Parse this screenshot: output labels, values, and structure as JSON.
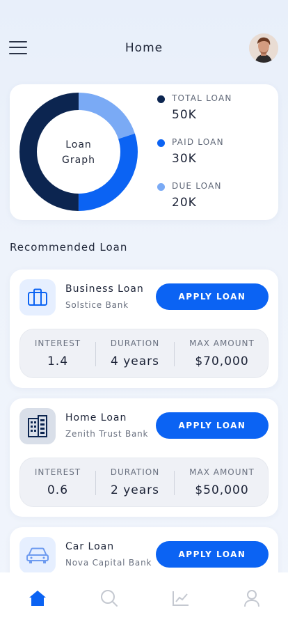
{
  "header": {
    "title": "Home",
    "menu_icon": "hamburger-menu-icon",
    "avatar": "user-avatar"
  },
  "graph": {
    "center_line1": "Loan",
    "center_line2": "Graph",
    "legend": [
      {
        "name": "TOTAL LOAN",
        "value": "50K",
        "color": "#0c2550"
      },
      {
        "name": "PAID LOAN",
        "value": "30K",
        "color": "#0b63f3"
      },
      {
        "name": "DUE LOAN",
        "value": "20K",
        "color": "#7aaaf5"
      }
    ]
  },
  "chart_data": {
    "type": "pie",
    "categories": [
      "TOTAL LOAN",
      "PAID LOAN",
      "DUE LOAN"
    ],
    "values": [
      50,
      30,
      20
    ],
    "colors": [
      "#0c2550",
      "#0b63f3",
      "#7aaaf5"
    ],
    "title": ""
  },
  "section": {
    "title": "Recommended Loan"
  },
  "loans": [
    {
      "name": "Business Loan",
      "bank": "Solstice Bank",
      "icon": "briefcase-icon",
      "apply_label": "APPLY LOAN",
      "interest_label": "INTEREST",
      "interest": "1.4",
      "duration_label": "DURATION",
      "duration": "4 years",
      "max_label": "MAX AMOUNT",
      "max_amount": "$70,000"
    },
    {
      "name": "Home Loan",
      "bank": "Zenith Trust Bank",
      "icon": "building-icon",
      "apply_label": "APPLY LOAN",
      "interest_label": "INTEREST",
      "interest": "0.6",
      "duration_label": "DURATION",
      "duration": "2 years",
      "max_label": "MAX AMOUNT",
      "max_amount": "$50,000"
    },
    {
      "name": "Car Loan",
      "bank": "Nova Capital Bank",
      "icon": "car-icon",
      "apply_label": "APPLY LOAN"
    }
  ],
  "nav": {
    "items": [
      "home-icon",
      "search-icon",
      "chart-icon",
      "profile-icon"
    ],
    "active_color": "#0b63f3",
    "inactive_color": "#c4c8d0"
  }
}
